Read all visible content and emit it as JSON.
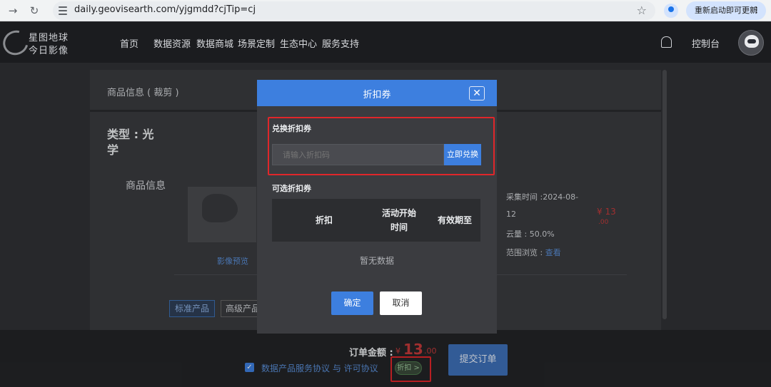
{
  "browser": {
    "url": "daily.geovisearth.com/yjgmdd?cjTip=cj",
    "update_label": "重新启动即可更新"
  },
  "header": {
    "logo_line1": "星图地球",
    "logo_line2": "今日影像",
    "nav": [
      "首页",
      "数据资源",
      "数据商城",
      "场景定制",
      "生态中心",
      "服务支持"
    ],
    "console": "控制台"
  },
  "page": {
    "panel_title": "商品信息 ( 裁剪 )",
    "type_label": "类型 : 光学",
    "info_label": "商品信息",
    "preview_link": "影像预览",
    "acq_time_line1": "采集时间 :2024-08-",
    "acq_time_line2": "12",
    "cloud": "云量 : 50.0%",
    "range_label": "范围浏览 : ",
    "range_link": "查看",
    "price": "¥ 13",
    "price_dec": ".00",
    "tag_standard": "标准产品",
    "tag_advanced": "高级产品"
  },
  "footer": {
    "order_label": "订单金额 :",
    "currency": "¥",
    "amount": "13",
    "amount_dec": ".00",
    "agreement": "数据产品服务协议 与 许可协议",
    "discount_chip": "折扣 >",
    "submit": "提交订单"
  },
  "modal": {
    "title": "折扣券",
    "redeem_title": "兑换折扣券",
    "code_placeholder": "请输入折扣码",
    "redeem_button": "立即兑换",
    "available_title": "可选折扣券",
    "columns": [
      "折扣",
      "活动开始时间",
      "有效期至"
    ],
    "empty_text": "暂无数据",
    "confirm": "确定",
    "cancel": "取消"
  },
  "colors": {
    "accent": "#3d7fdf",
    "price_red": "#c43a3a",
    "highlight_red": "#e0262a"
  }
}
